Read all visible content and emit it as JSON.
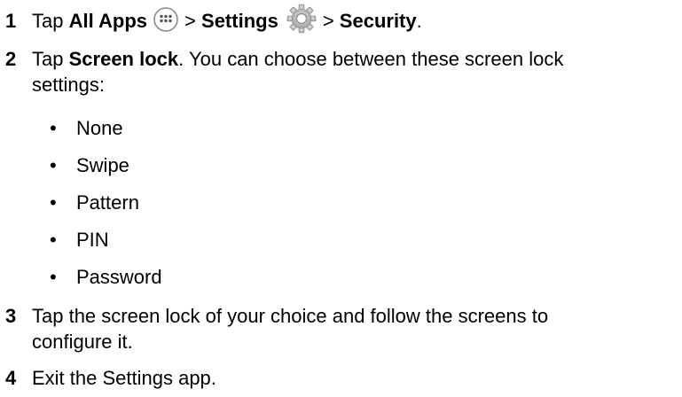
{
  "steps": [
    {
      "number": "1",
      "parts": {
        "tap": "Tap",
        "all_apps": "All Apps",
        "sep1": ">",
        "settings": "Settings",
        "sep2": ">",
        "security": "Security",
        "end": "."
      },
      "icons": [
        "all-apps-icon",
        "settings-gear-icon"
      ]
    },
    {
      "number": "2",
      "parts": {
        "tap": "Tap",
        "screen_lock": "Screen lock",
        "rest_line1": ". You can choose between these screen lock",
        "rest_line2": "settings:"
      }
    },
    {
      "number": "3",
      "line1": "Tap the screen lock of your choice and follow the screens to",
      "line2": "configure it."
    },
    {
      "number": "4",
      "line1": "Exit the Settings app."
    }
  ],
  "bullets": [
    "None",
    "Swipe",
    "Pattern",
    "PIN",
    "Password"
  ],
  "bullet_glyph": "•",
  "colors": {
    "text": "#000000",
    "icon_gray": "#8a8a8a"
  }
}
